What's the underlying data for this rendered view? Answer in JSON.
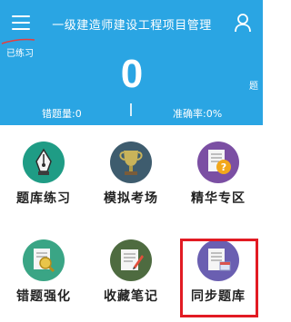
{
  "header": {
    "title": "一级建造师建设工程项目管理",
    "practiced_label": "已练习",
    "count": "0",
    "unit": "题",
    "wrong_count": "错题量:0",
    "separator": "|",
    "accuracy": "准确率:0%"
  },
  "colors": {
    "header_bg": "#2aa5e3",
    "highlight_border": "#e21b23"
  },
  "grid": {
    "items": [
      {
        "label": "题库练习",
        "icon": "pen-nib-icon",
        "color": "#1f9c85"
      },
      {
        "label": "模拟考场",
        "icon": "trophy-icon",
        "color": "#3e5c6e"
      },
      {
        "label": "精华专区",
        "icon": "question-document-icon",
        "color": "#7b4fa3"
      },
      {
        "label": "错题强化",
        "icon": "magnifier-document-icon",
        "color": "#3aa585"
      },
      {
        "label": "收藏笔记",
        "icon": "note-pencil-icon",
        "color": "#4e6b40"
      },
      {
        "label": "同步题库",
        "icon": "sync-document-icon",
        "color": "#6a5fb1"
      }
    ]
  }
}
